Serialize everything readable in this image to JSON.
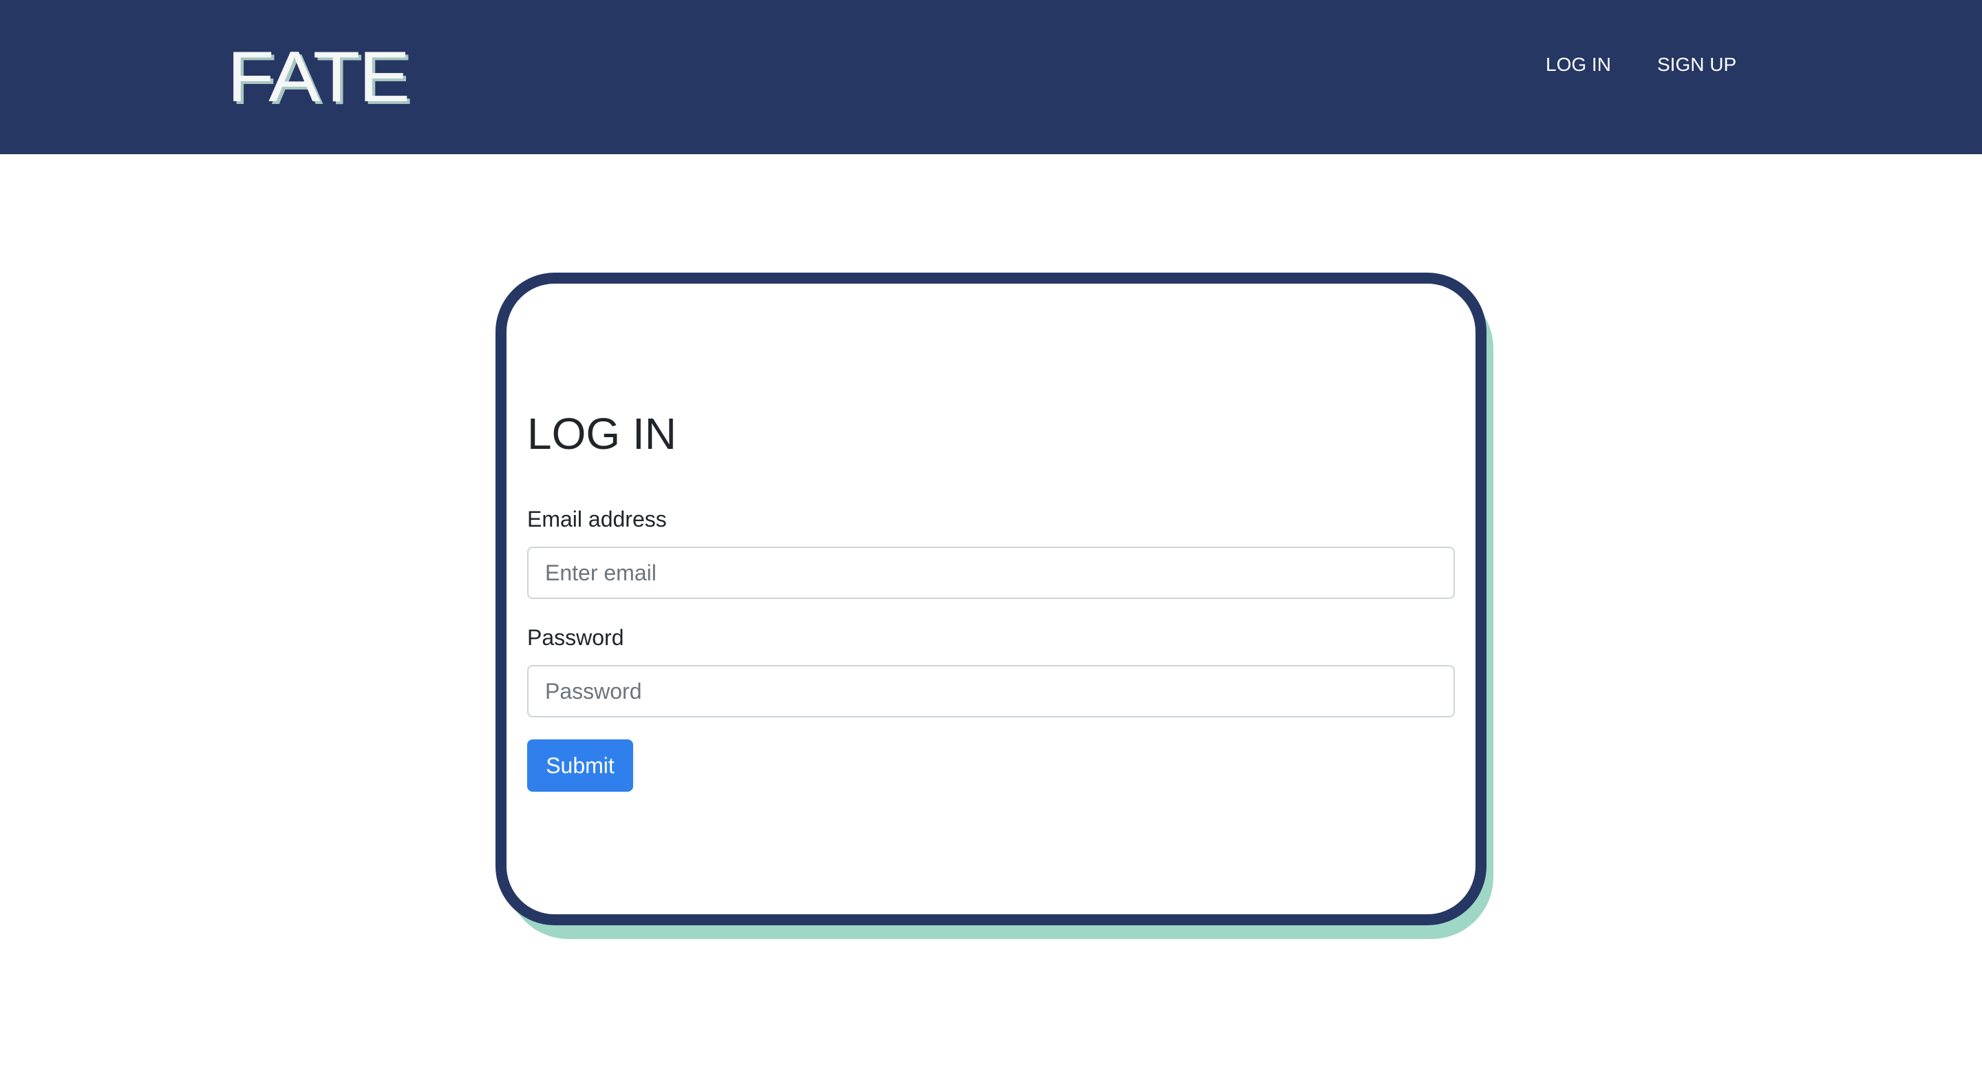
{
  "navbar": {
    "logo_text": "FATE",
    "links": [
      {
        "label": "LOG IN"
      },
      {
        "label": "SIGN UP"
      }
    ]
  },
  "login_form": {
    "title": "LOG IN",
    "email": {
      "label": "Email address",
      "placeholder": "Enter email",
      "value": ""
    },
    "password": {
      "label": "Password",
      "placeholder": "Password",
      "value": ""
    },
    "submit_label": "Submit"
  },
  "colors": {
    "navbar_background": "#263764",
    "card_border": "#263764",
    "card_shadow": "#9fd7c6",
    "submit_button": "#2f80ed",
    "page_background": "#ffffff"
  }
}
